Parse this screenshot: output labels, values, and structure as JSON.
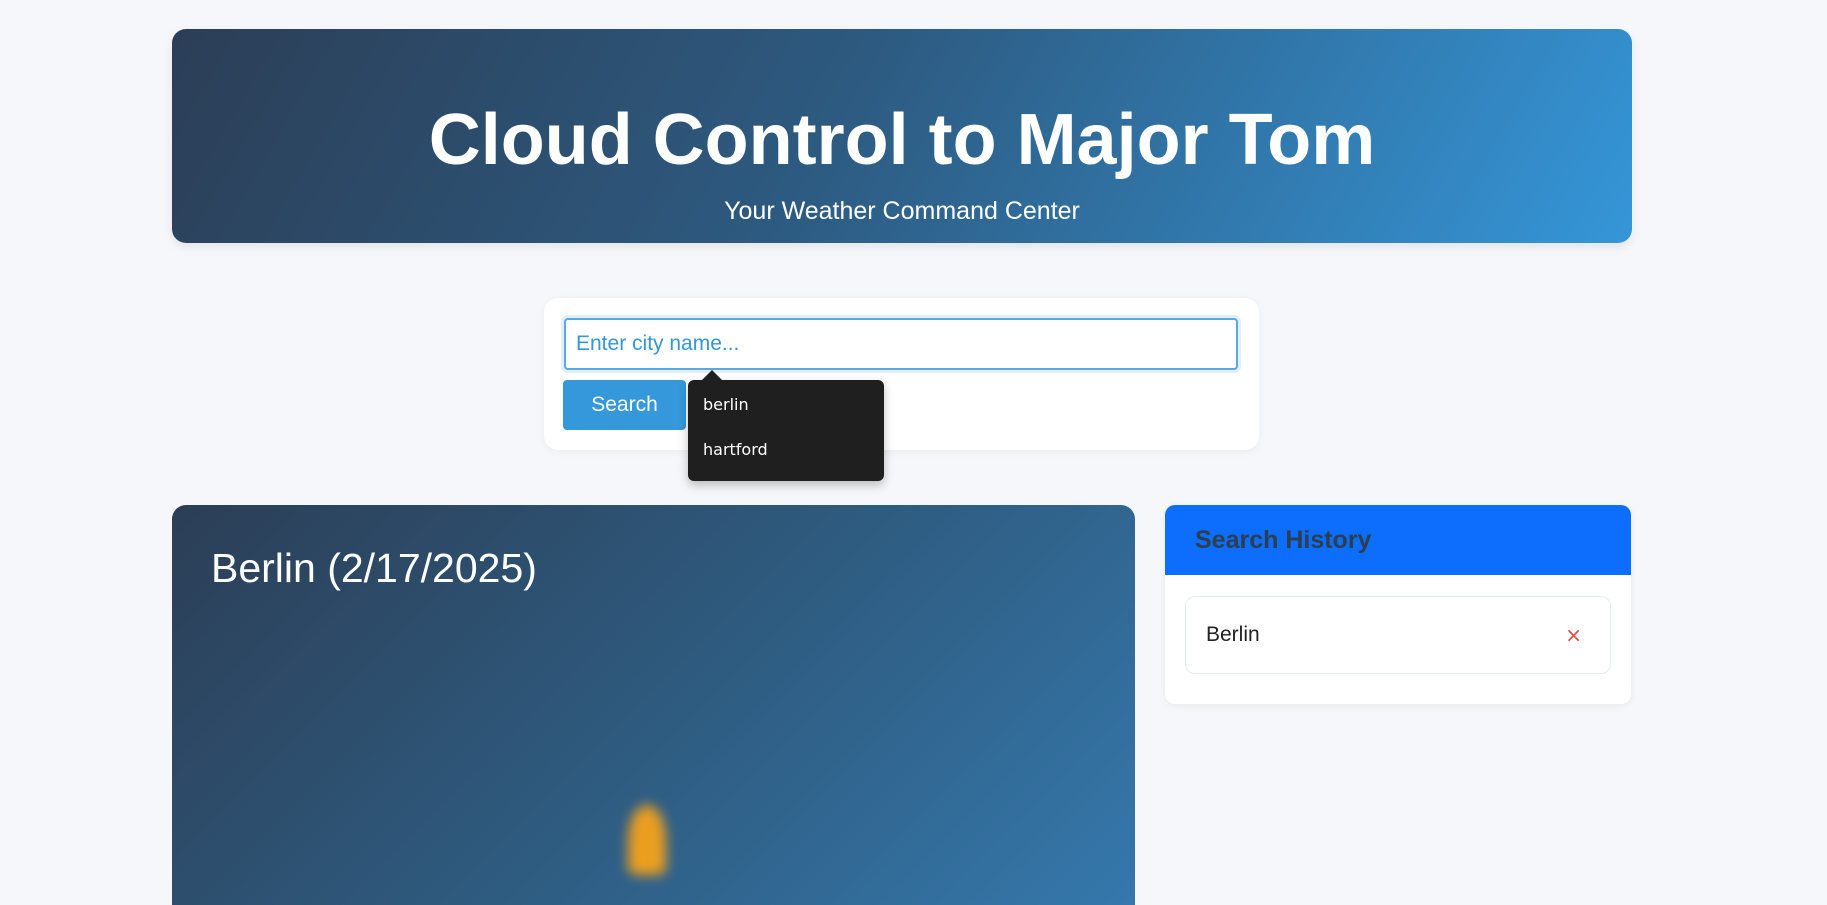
{
  "header": {
    "title": "Cloud Control to Major Tom",
    "subtitle": "Your Weather Command Center"
  },
  "search": {
    "placeholder": "Enter city name...",
    "button_label": "Search",
    "suggestions": [
      "berlin",
      "hartford"
    ]
  },
  "weather": {
    "title": "Berlin (2/17/2025)",
    "icon": "sun-icon"
  },
  "history": {
    "title": "Search History",
    "items": [
      {
        "label": "Berlin",
        "remove_glyph": "×"
      }
    ]
  },
  "colors": {
    "accent": "#3598db",
    "history_header": "#0d6efd",
    "remove": "#e74c3c"
  }
}
